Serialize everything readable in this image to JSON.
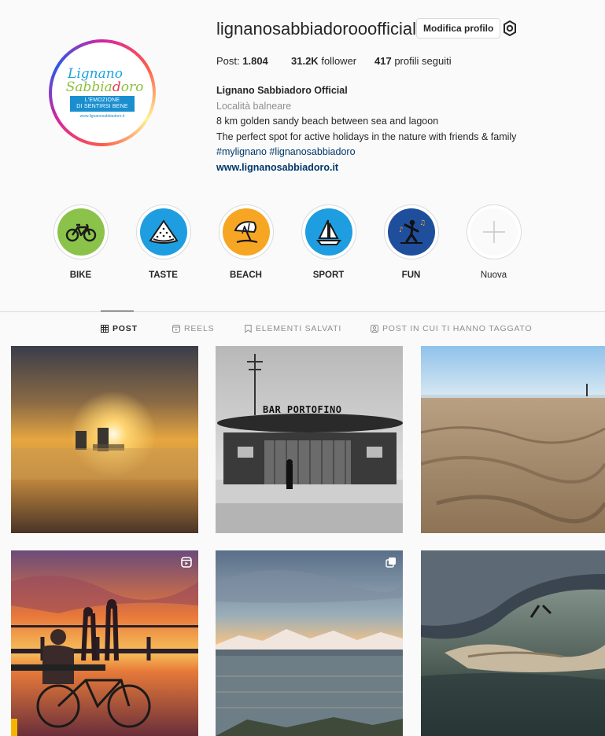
{
  "profile": {
    "username": "lignanosabbiadorooofficial",
    "edit_label": "Modifica profilo",
    "logo": {
      "line1": "Lignano",
      "line2a": "Sabbia",
      "line2b": "d",
      "line2c": "oro",
      "banner1": "L'EMOZIONE",
      "banner2": "DI SENTIRSI BENE",
      "url": "www.lignanosabbiadoro.it"
    },
    "stats": {
      "posts_label": "Post:",
      "posts_value": "1.804",
      "followers_value": "31.2K",
      "followers_label": "follower",
      "following_value": "417",
      "following_label": "profili seguiti"
    },
    "bio": {
      "name": "Lignano Sabbiadoro Official",
      "category": "Località balneare",
      "line1": "8 km golden sandy beach between sea and lagoon",
      "line2": "The perfect spot for active holidays in the nature with friends & family",
      "hashtags": "#mylignano #lignanosabbiadoro",
      "website": "www.lignanosabbiadoro.it"
    }
  },
  "highlights": [
    {
      "label": "BIKE",
      "icon": "bike-icon",
      "color": "#8bc34a"
    },
    {
      "label": "TASTE",
      "icon": "watermelon-icon",
      "color": "#1e9ee0"
    },
    {
      "label": "BEACH",
      "icon": "umbrella-icon",
      "color": "#f6a623"
    },
    {
      "label": "SPORT",
      "icon": "sailboat-icon",
      "color": "#1e9ee0"
    },
    {
      "label": "FUN",
      "icon": "dancer-icon",
      "color": "#1f4f9c"
    },
    {
      "label": "Nuova",
      "icon": "plus-icon",
      "color": "#fafafa"
    }
  ],
  "tabs": [
    {
      "label": "POST",
      "icon": "grid-icon",
      "active": true
    },
    {
      "label": "REELS",
      "icon": "reels-icon",
      "active": false
    },
    {
      "label": "ELEMENTI SALVATI",
      "icon": "bookmark-icon",
      "active": false
    },
    {
      "label": "POST IN CUI TI HANNO TAGGATO",
      "icon": "tag-user-icon",
      "active": false
    }
  ],
  "posts": [
    {
      "subject": "foggy-sunrise-city",
      "badge": ""
    },
    {
      "subject": "bar-portofino-bw",
      "badge": "",
      "sign": "BAR PORTOFINO"
    },
    {
      "subject": "sand-dunes",
      "badge": ""
    },
    {
      "subject": "sunset-bike-couple",
      "badge": "reel-icon"
    },
    {
      "subject": "lagoon-mountains",
      "badge": "carousel-icon"
    },
    {
      "subject": "aerial-plane-wing",
      "badge": ""
    }
  ]
}
